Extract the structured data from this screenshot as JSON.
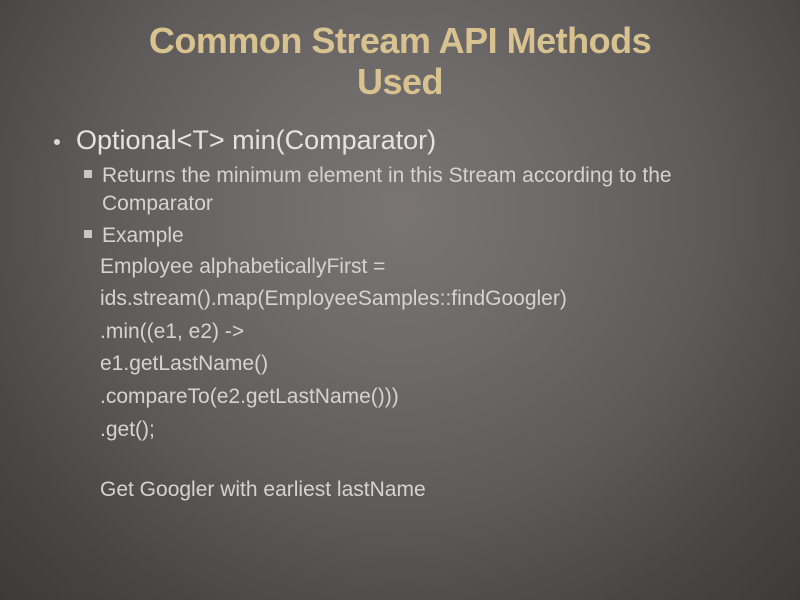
{
  "title_line1": "Common Stream API Methods",
  "title_line2": "Used",
  "bullet1": "Optional<T> min(Comparator)",
  "sub1": "Returns the minimum element in this Stream according to the Comparator",
  "sub2": "Example",
  "code_lines": [
    "Employee alphabeticallyFirst =",
    "ids.stream().map(EmployeeSamples::findGoogler)",
    ".min((e1, e2) ->",
    "e1.getLastName()",
    ".compareTo(e2.getLastName()))",
    ".get();"
  ],
  "note": "Get Googler with earliest lastName"
}
